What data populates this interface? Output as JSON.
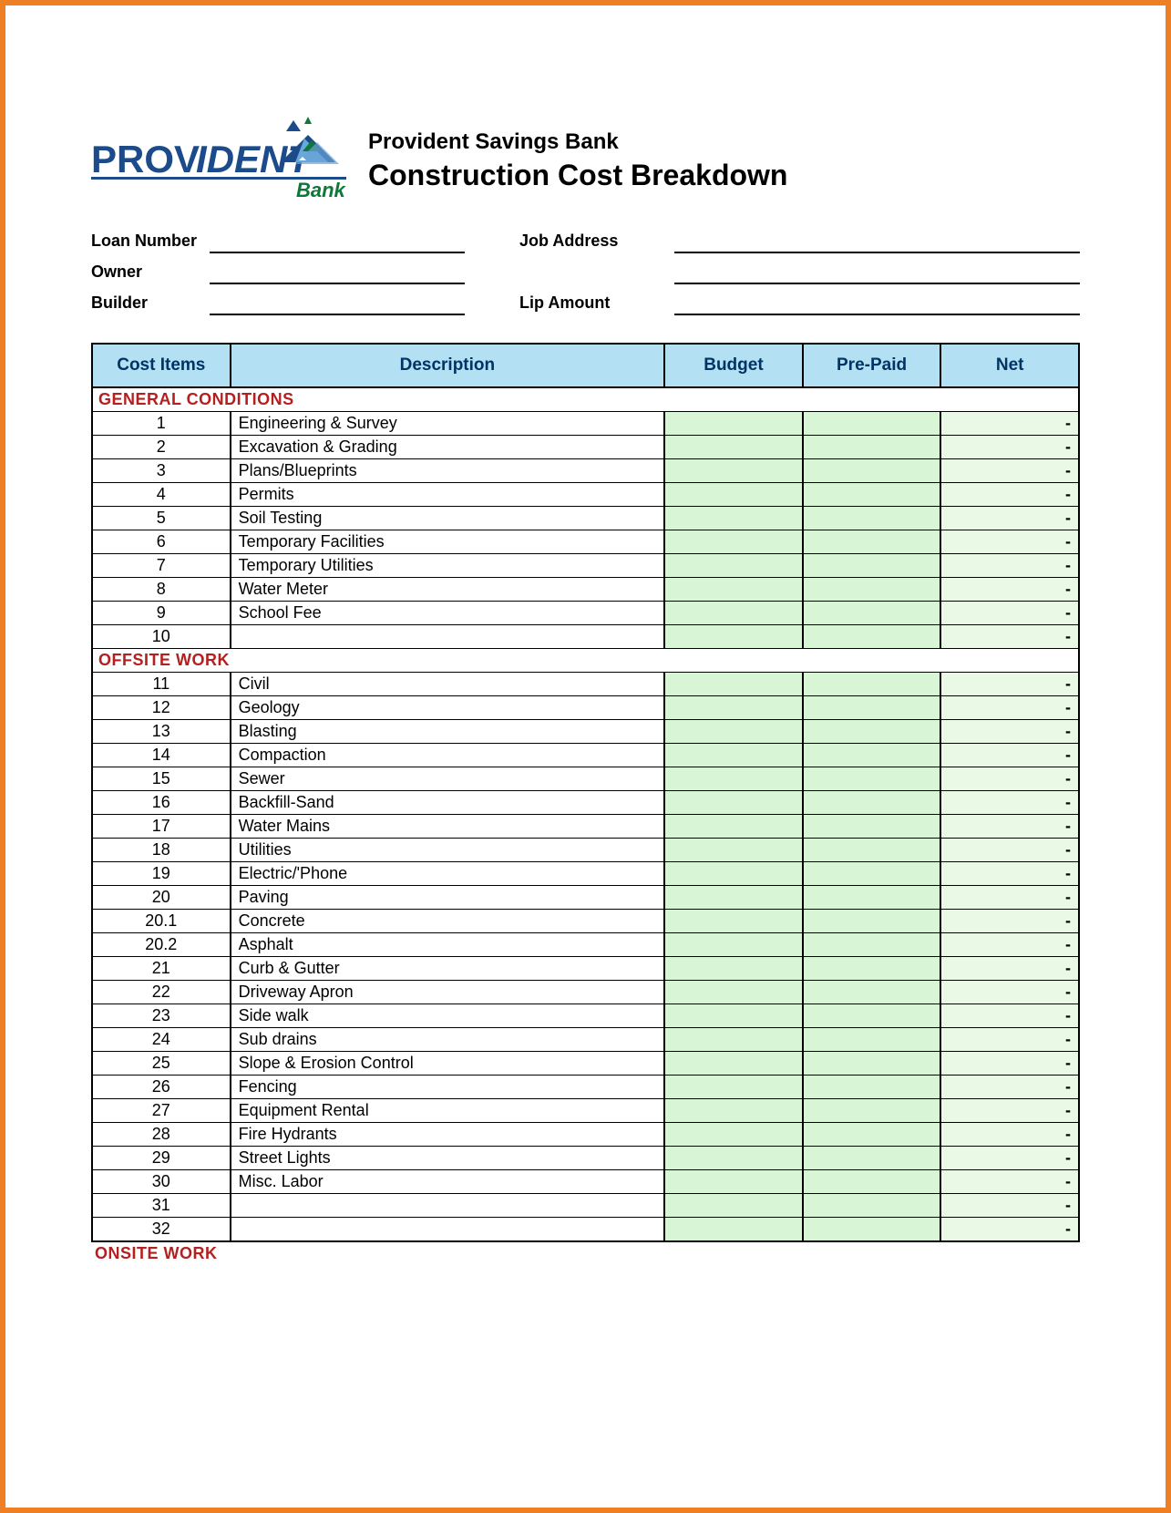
{
  "header": {
    "bank_name": "Provident Savings Bank",
    "title": "Construction Cost Breakdown",
    "logo_text_main": "PROV",
    "logo_text_italic": "IDENT",
    "logo_sub": "Bank"
  },
  "form": {
    "loan_number_label": "Loan Number",
    "job_address_label": "Job Address",
    "owner_label": "Owner",
    "builder_label": "Builder",
    "lip_amount_label": "Lip Amount"
  },
  "table": {
    "headers": {
      "cost_items": "Cost  Items",
      "description": "Description",
      "budget": "Budget",
      "prepaid": "Pre-Paid",
      "net": "Net"
    },
    "sections": [
      {
        "title": "GENERAL CONDITIONS",
        "rows": [
          {
            "n": "1",
            "d": "Engineering & Survey",
            "net": "-"
          },
          {
            "n": "2",
            "d": "Excavation & Grading",
            "net": "-"
          },
          {
            "n": "3",
            "d": "Plans/Blueprints",
            "net": "-"
          },
          {
            "n": "4",
            "d": "Permits",
            "net": "-"
          },
          {
            "n": "5",
            "d": "Soil Testing",
            "net": "-"
          },
          {
            "n": "6",
            "d": "Temporary Facilities",
            "net": "-"
          },
          {
            "n": "7",
            "d": "Temporary Utilities",
            "net": "-"
          },
          {
            "n": "8",
            "d": "Water Meter",
            "net": "-"
          },
          {
            "n": "9",
            "d": "School Fee",
            "net": "-"
          },
          {
            "n": "10",
            "d": "",
            "net": "-"
          }
        ]
      },
      {
        "title": "OFFSITE WORK",
        "rows": [
          {
            "n": "11",
            "d": "Civil",
            "net": "-"
          },
          {
            "n": "12",
            "d": "Geology",
            "net": "-"
          },
          {
            "n": "13",
            "d": "Blasting",
            "net": "-"
          },
          {
            "n": "14",
            "d": "Compaction",
            "net": "-"
          },
          {
            "n": "15",
            "d": "Sewer",
            "net": "-"
          },
          {
            "n": "16",
            "d": "Backfill-Sand",
            "net": "-"
          },
          {
            "n": "17",
            "d": "Water Mains",
            "net": "-"
          },
          {
            "n": "18",
            "d": "Utilities",
            "net": "-"
          },
          {
            "n": "19",
            "d": "Electric/'Phone",
            "net": "-"
          },
          {
            "n": "20",
            "d": "Paving",
            "net": "-"
          },
          {
            "n": "20.1",
            "d": "Concrete",
            "net": "-"
          },
          {
            "n": "20.2",
            "d": "Asphalt",
            "net": "-"
          },
          {
            "n": "21",
            "d": "Curb & Gutter",
            "net": "-"
          },
          {
            "n": "22",
            "d": "Driveway Apron",
            "net": "-"
          },
          {
            "n": "23",
            "d": "Side walk",
            "net": "-"
          },
          {
            "n": "24",
            "d": "Sub drains",
            "net": "-"
          },
          {
            "n": "25",
            "d": "Slope & Erosion Control",
            "net": "-"
          },
          {
            "n": "26",
            "d": "Fencing",
            "net": "-"
          },
          {
            "n": "27",
            "d": "Equipment Rental",
            "net": "-"
          },
          {
            "n": "28",
            "d": "Fire Hydrants",
            "net": "-"
          },
          {
            "n": "29",
            "d": "Street Lights",
            "net": "-"
          },
          {
            "n": "30",
            "d": "Misc. Labor",
            "net": "-"
          },
          {
            "n": "31",
            "d": "",
            "net": "-"
          },
          {
            "n": "32",
            "d": "",
            "net": "-"
          }
        ]
      }
    ],
    "trailing_section": "ONSITE WORK"
  }
}
